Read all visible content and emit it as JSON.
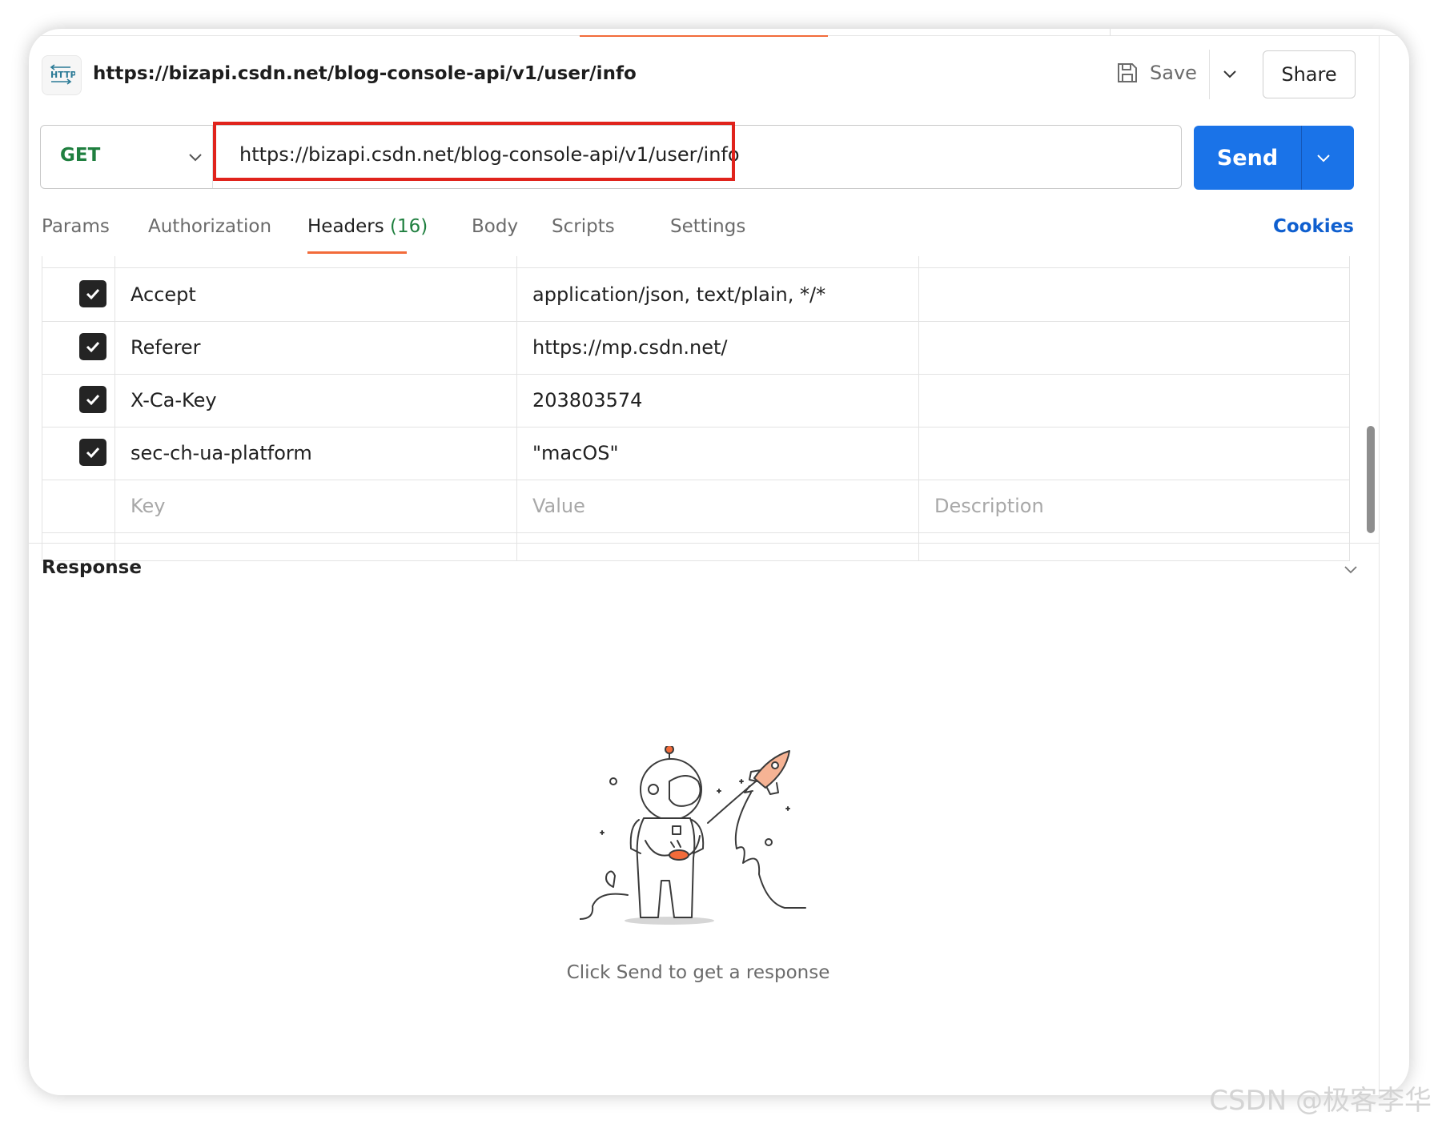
{
  "request": {
    "title": "https://bizapi.csdn.net/blog-console-api/v1/user/info",
    "icon_label": "HTTP",
    "save_label": "Save",
    "share_label": "Share"
  },
  "url_bar": {
    "method": "GET",
    "url": "https://bizapi.csdn.net/blog-console-api/v1/user/info",
    "send_label": "Send"
  },
  "tabs": [
    {
      "label": "Params"
    },
    {
      "label": "Authorization"
    },
    {
      "label": "Headers",
      "count": "(16)"
    },
    {
      "label": "Body"
    },
    {
      "label": "Scripts"
    },
    {
      "label": "Settings"
    }
  ],
  "cookies_label": "Cookies",
  "headers_table": {
    "rows": [
      {
        "key": "Accept",
        "value": "application/json, text/plain, */*",
        "checked": true
      },
      {
        "key": "Referer",
        "value": "https://mp.csdn.net/",
        "checked": true
      },
      {
        "key": "X-Ca-Key",
        "value": "203803574",
        "checked": true
      },
      {
        "key": "sec-ch-ua-platform",
        "value": "\"macOS\"",
        "checked": true
      }
    ],
    "placeholders": {
      "key": "Key",
      "value": "Value",
      "description": "Description"
    }
  },
  "response": {
    "title": "Response",
    "empty_message": "Click Send to get a response"
  },
  "watermark": "CSDN @极客李华",
  "colors": {
    "accent_orange": "#f26b3a",
    "send_blue": "#1a73e8",
    "method_green": "#1f7f3f",
    "cookies_blue": "#0f5fcf",
    "highlight_red": "#e0231c"
  }
}
